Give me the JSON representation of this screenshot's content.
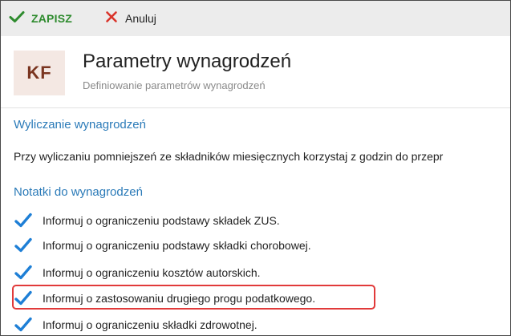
{
  "toolbar": {
    "save_label": "ZAPISZ",
    "cancel_label": "Anuluj",
    "save_icon": "checkmark-icon",
    "cancel_icon": "close-icon"
  },
  "header": {
    "badge": "KF",
    "title": "Parametry wynagrodzeń",
    "subtitle": "Definiowanie parametrów wynagrodzeń"
  },
  "sections": {
    "calc": {
      "title": "Wyliczanie wynagrodzeń",
      "description": "Przy wyliczaniu pomniejszeń ze składników miesięcznych korzystaj z godzin do przepr"
    },
    "notes": {
      "title": "Notatki do wynagrodzeń",
      "items": [
        {
          "label": "Informuj o ograniczeniu podstawy składek ZUS.",
          "checked": true
        },
        {
          "label": "Informuj o ograniczeniu podstawy składki chorobowej.",
          "checked": true
        },
        {
          "label": "Informuj o ograniczeniu kosztów autorskich.",
          "checked": true
        },
        {
          "label": "Informuj o zastosowaniu drugiego progu podatkowego.",
          "checked": true,
          "highlighted": true
        },
        {
          "label": "Informuj o ograniczeniu składki zdrowotnej.",
          "checked": true
        }
      ]
    }
  },
  "colors": {
    "accent_link": "#2a7ab8",
    "save_green": "#2e8b2e",
    "cancel_red": "#d9342b",
    "checkbox_blue": "#1e7fd6",
    "highlight_red": "#e13a3a",
    "badge_bg": "#f4e8e3",
    "badge_text": "#7a3520"
  }
}
